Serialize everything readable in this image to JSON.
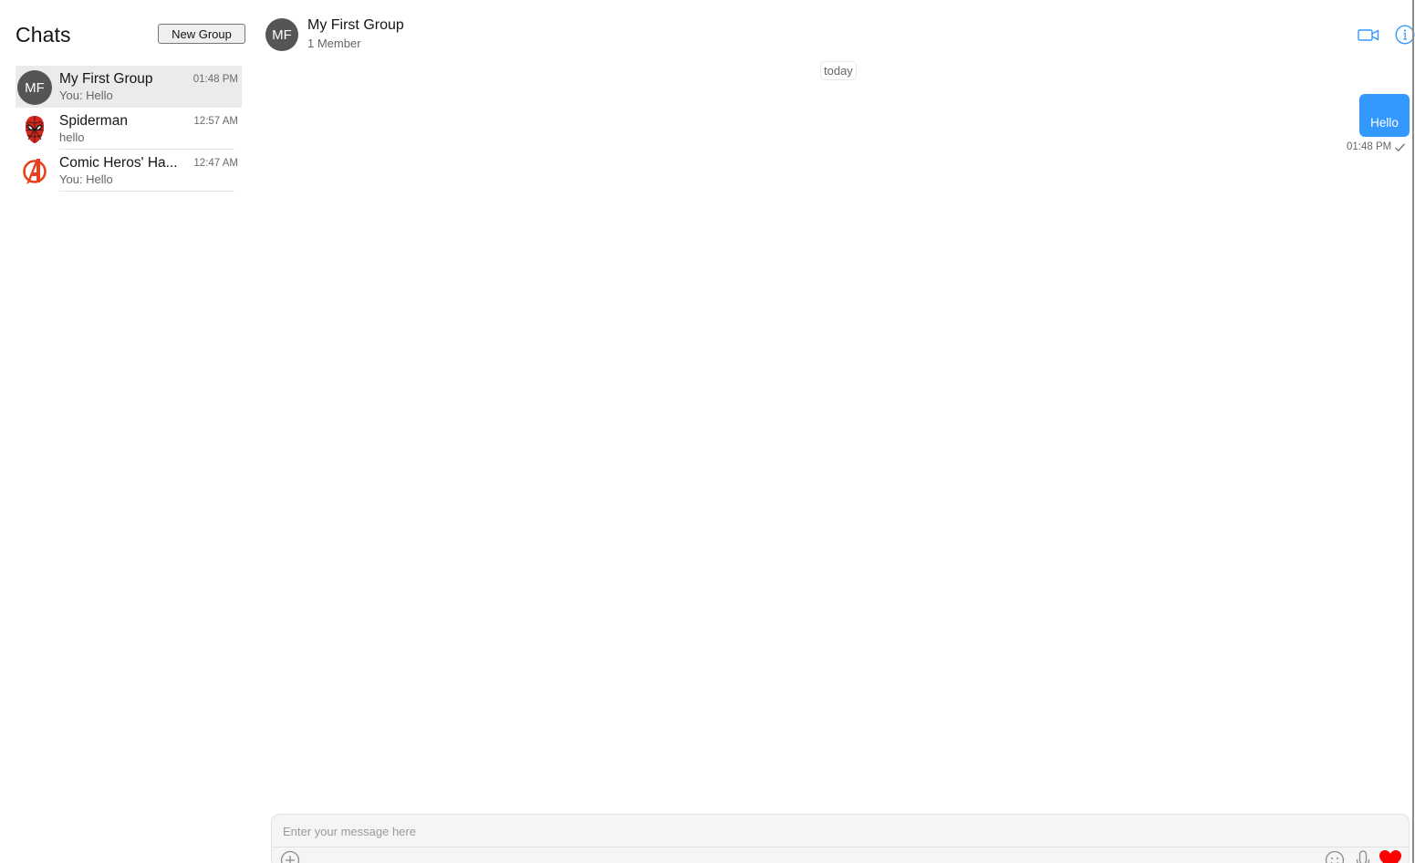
{
  "sidebar": {
    "title": "Chats",
    "new_group_label": "New Group",
    "chats": [
      {
        "name": "My First Group",
        "time": "01:48 PM",
        "preview": "You: Hello",
        "avatar_initials": "MF",
        "active": true
      },
      {
        "name": "Spiderman",
        "time": "12:57 AM",
        "preview": "hello",
        "avatar_icon": "spiderman-mask-icon"
      },
      {
        "name": "Comic Heros' Ha...",
        "time": "12:47 AM",
        "preview": "You: Hello",
        "avatar_icon": "avengers-logo-icon"
      }
    ]
  },
  "header": {
    "avatar_initials": "MF",
    "title": "My First Group",
    "subtitle": "1 Member",
    "icons": [
      "video-call-icon",
      "info-icon"
    ]
  },
  "conversation": {
    "day_label": "today",
    "messages": [
      {
        "text": "Hello",
        "time": "01:48 PM",
        "outgoing": true,
        "status_icon": "check-icon"
      }
    ]
  },
  "composer": {
    "placeholder": "Enter your message here",
    "icons": [
      "add-attachment-icon",
      "emoji-icon",
      "microphone-icon",
      "heart-icon"
    ]
  },
  "colors": {
    "accent": "#3399ff",
    "avatar_bg": "#555555",
    "active_row": "#ebebeb",
    "heart": "#ff0000"
  }
}
